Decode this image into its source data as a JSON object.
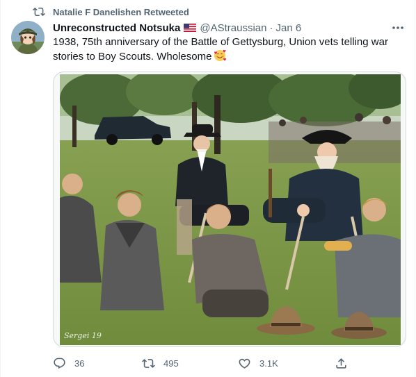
{
  "retweet_header": {
    "label": "Natalie F Danelishen Retweeted",
    "icon": "retweet-icon"
  },
  "tweet": {
    "author_name": "Unreconstructed Notsuka",
    "flag_icon": "us-flag-icon",
    "handle": "@AStraussian",
    "separator": "·",
    "date": "Jan 6",
    "text": "1938, 75th anniversary of the Battle of Gettysburg, Union vets telling war stories to Boy Scouts. Wholesome",
    "emoji_icon": "smiling-face-with-hearts-icon",
    "photo_watermark": "Sergei 19"
  },
  "actions": {
    "reply": {
      "icon": "reply-icon",
      "count": "36"
    },
    "retweet": {
      "icon": "retweet-icon",
      "count": "495"
    },
    "like": {
      "icon": "heart-icon",
      "count": "3.1K"
    },
    "share": {
      "icon": "share-icon"
    }
  },
  "colors": {
    "text": "#0f1419",
    "secondary": "#536471",
    "border": "#cfd9de"
  }
}
